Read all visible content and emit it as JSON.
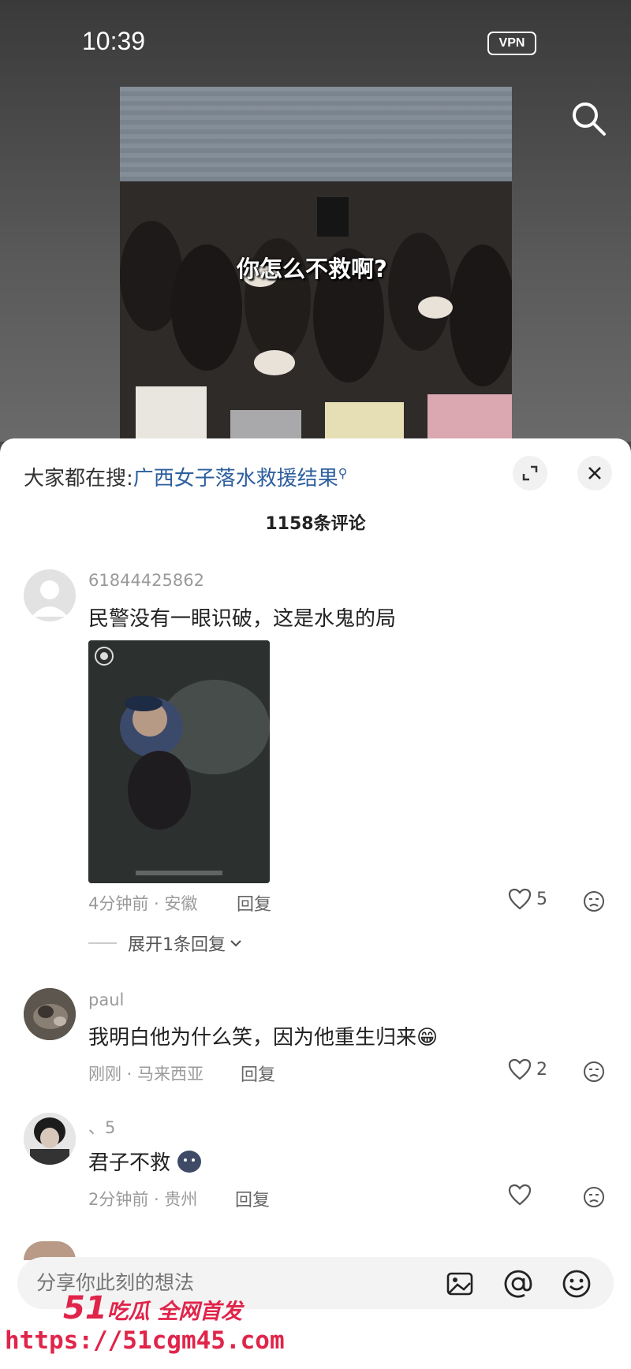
{
  "status_bar": {
    "time": "10:39",
    "vpn": "VPN"
  },
  "video": {
    "caption": "你怎么不救啊?"
  },
  "comments_panel": {
    "search_prefix": "大家都在搜:",
    "search_link": "广西女子落水救援结果",
    "count_title": "1158条评论",
    "comments": [
      {
        "user": "61844425862",
        "text": "民警没有一眼识破，这是水鬼的局",
        "meta": "4分钟前 · 安徽",
        "reply": "回复",
        "likes": "5",
        "expand": "展开1条回复"
      },
      {
        "user": "paul",
        "text": "我明白他为什么笑，因为他重生归来",
        "emoji": "😁",
        "meta": "刚刚 · 马来西亚",
        "reply": "回复",
        "likes": "2"
      },
      {
        "user": "、5",
        "text": "君子不救",
        "meta": "2分钟前 · 贵州",
        "reply": "回复",
        "likes": ""
      }
    ]
  },
  "input_bar": {
    "placeholder": "分享你此刻的想法"
  },
  "watermark": {
    "num": "51",
    "line1": "吃瓜 全网首发",
    "line2": "https://51cgm45.com"
  },
  "icons": {
    "search": "search-icon",
    "fullscreen": "expand-icon",
    "close": "close-icon",
    "like": "heart-icon",
    "dislike": "dislike-face-icon",
    "image": "image-icon",
    "mention": "at-icon",
    "emoji": "emoji-icon"
  }
}
